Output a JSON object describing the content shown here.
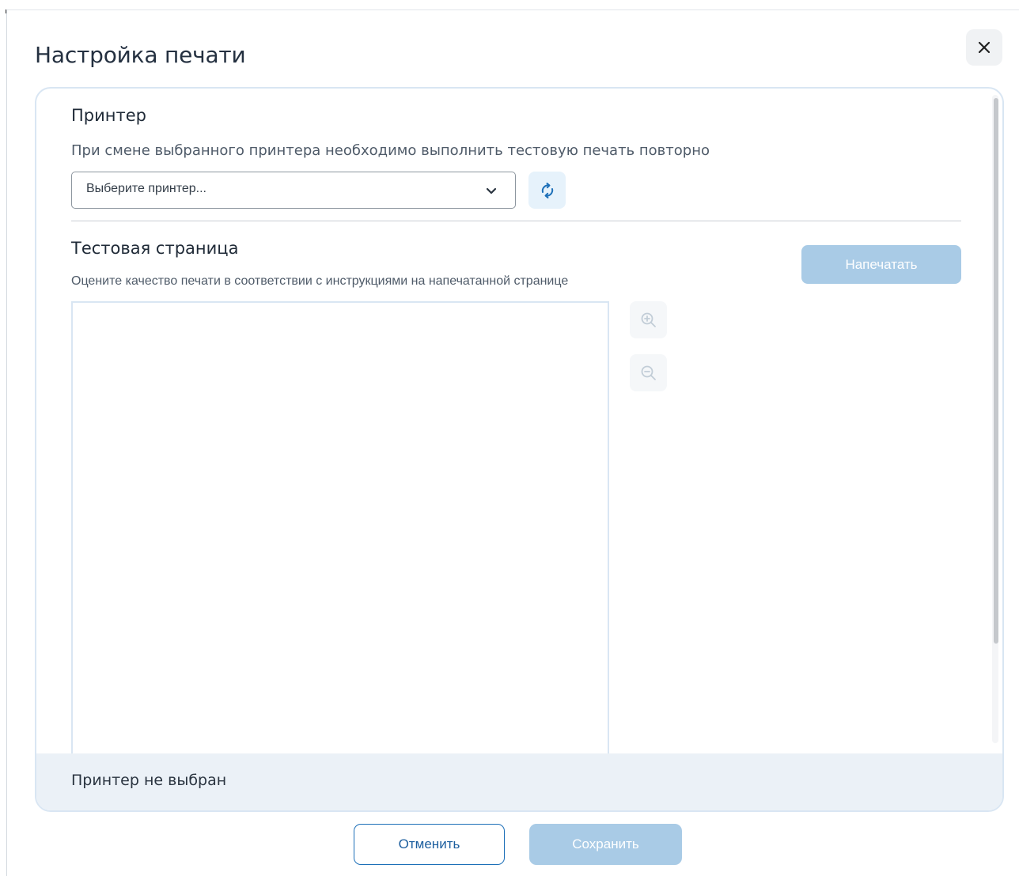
{
  "dialog": {
    "title": "Настройка печати",
    "close_icon": "close-icon"
  },
  "printer_section": {
    "heading": "Принтер",
    "description": "При смене выбранного принтера необходимо выполнить тестовую печать повторно",
    "select_placeholder": "Выберите принтер...",
    "refresh_icon": "refresh-icon"
  },
  "test_section": {
    "heading": "Тестовая страница",
    "description": "Оцените качество печати в соответствии с инструкциями на напечатанной странице",
    "print_label": "Напечатать",
    "zoom_in_icon": "zoom-in-icon",
    "zoom_out_icon": "zoom-out-icon"
  },
  "status": {
    "text": "Принтер не выбран"
  },
  "footer": {
    "cancel_label": "Отменить",
    "save_label": "Сохранить"
  },
  "colors": {
    "accent": "#1c6fb8",
    "disabled_button": "#a9cbe6",
    "panel_border": "#d9e6f3",
    "status_bg": "#ebf1f7"
  }
}
